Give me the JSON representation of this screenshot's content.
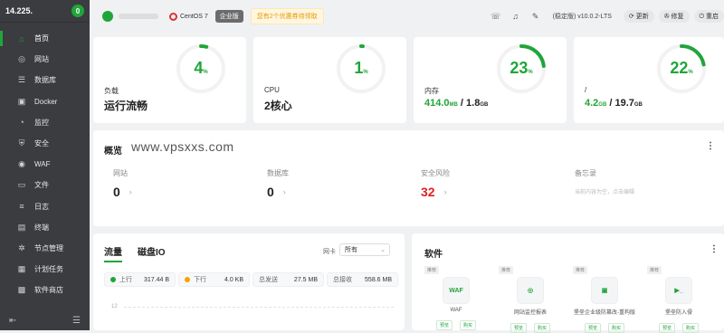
{
  "sidebar": {
    "ip": "14.225.",
    "count": "0",
    "items": [
      {
        "label": "首页",
        "icon": "home-icon",
        "glyph": "⌂"
      },
      {
        "label": "网站",
        "icon": "globe-icon",
        "glyph": "◎"
      },
      {
        "label": "数据库",
        "icon": "database-icon",
        "glyph": "☰"
      },
      {
        "label": "Docker",
        "icon": "docker-icon",
        "glyph": "▣"
      },
      {
        "label": "监控",
        "icon": "monitor-icon",
        "glyph": "◔"
      },
      {
        "label": "安全",
        "icon": "shield-icon",
        "glyph": "⛨"
      },
      {
        "label": "WAF",
        "icon": "waf-icon",
        "glyph": "◉"
      },
      {
        "label": "文件",
        "icon": "folder-icon",
        "glyph": "▭"
      },
      {
        "label": "日志",
        "icon": "log-icon",
        "glyph": "≡"
      },
      {
        "label": "终端",
        "icon": "terminal-icon",
        "glyph": "▤"
      },
      {
        "label": "节点管理",
        "icon": "node-icon",
        "glyph": "✲"
      },
      {
        "label": "计划任务",
        "icon": "calendar-icon",
        "glyph": "▦"
      },
      {
        "label": "软件商店",
        "icon": "store-icon",
        "glyph": "▩"
      }
    ]
  },
  "topbar": {
    "os": "CentOS 7",
    "edition": "企业版",
    "promo": "您有2个优惠券待领取",
    "version": "(稳定版) v10.0.2-LTS",
    "update": "更新",
    "repair": "修复",
    "restart": "重启"
  },
  "stats": {
    "load": {
      "label": "负载",
      "status": "运行流畅",
      "percent": 4
    },
    "cpu": {
      "label": "CPU",
      "cores": "2核心",
      "percent": 1
    },
    "memory": {
      "label": "内存",
      "used": "414.0",
      "used_unit": "MB",
      "total": "1.8",
      "total_unit": "GB",
      "percent": 23
    },
    "disk": {
      "label": "/",
      "used": "4.2",
      "used_unit": "GB",
      "total": "19.7",
      "total_unit": "GB",
      "percent": 22
    }
  },
  "percent_sign": "%",
  "overview": {
    "title": "概览",
    "watermark": "www.vpsxxs.com",
    "site_label": "网站",
    "site_value": "0",
    "db_label": "数据库",
    "db_value": "0",
    "risk_label": "安全风险",
    "risk_value": "32",
    "memo_label": "备忘录",
    "memo_text": "当前内容为空，点击编辑"
  },
  "traffic": {
    "tab_flow": "流量",
    "tab_disk": "磁盘IO",
    "nic_label": "网卡",
    "nic_value": "所有",
    "up_label": "上行",
    "up_value": "317.44 B",
    "down_label": "下行",
    "down_value": "4.0 KB",
    "sent_label": "总发送",
    "sent_value": "27.5 MB",
    "recv_label": "总接收",
    "recv_value": "558.6 MB",
    "axis_tick": "12"
  },
  "software": {
    "title": "软件",
    "items": [
      {
        "name": "WAF",
        "tag": "推荐",
        "icon": "waf-shield-icon",
        "glyph": "WAF"
      },
      {
        "name": "网站监控报表",
        "tag": "推荐",
        "icon": "report-icon",
        "glyph": "◎"
      },
      {
        "name": "堡垒企业级防篡改-重构版",
        "tag": "推荐",
        "icon": "lock-icon",
        "glyph": "▣"
      },
      {
        "name": "堡垒防入侵",
        "tag": "推荐",
        "icon": "intrusion-icon",
        "glyph": "▶_"
      }
    ],
    "btn_preview": "预览",
    "btn_buy": "购买"
  }
}
